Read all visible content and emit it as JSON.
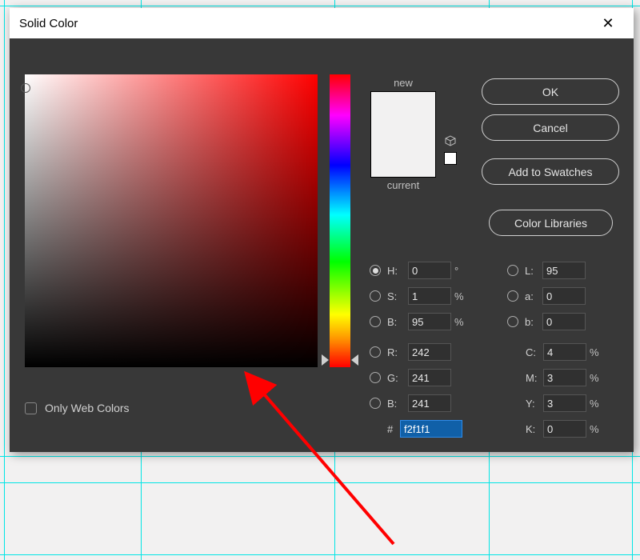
{
  "dialog": {
    "title": "Solid Color",
    "new_label": "new",
    "current_label": "current",
    "web_only": "Only Web Colors"
  },
  "buttons": {
    "ok": "OK",
    "cancel": "Cancel",
    "swatches": "Add to Swatches",
    "libraries": "Color Libraries"
  },
  "hsb": {
    "h_label": "H:",
    "h_value": "0",
    "h_unit": "°",
    "s_label": "S:",
    "s_value": "1",
    "s_unit": "%",
    "b_label": "B:",
    "b_value": "95",
    "b_unit": "%"
  },
  "lab": {
    "l_label": "L:",
    "l_value": "95",
    "a_label": "a:",
    "a_value": "0",
    "b_label": "b:",
    "b_value": "0"
  },
  "rgb": {
    "r_label": "R:",
    "r_value": "242",
    "g_label": "G:",
    "g_value": "241",
    "b_label": "B:",
    "b_value": "241"
  },
  "cmyk": {
    "c_label": "C:",
    "c_value": "4",
    "unit": "%",
    "m_label": "M:",
    "m_value": "3",
    "y_label": "Y:",
    "y_value": "3",
    "k_label": "K:",
    "k_value": "0"
  },
  "hex": {
    "label": "#",
    "value": "f2f1f1"
  },
  "colors": {
    "preview": "#f2f1f1"
  }
}
